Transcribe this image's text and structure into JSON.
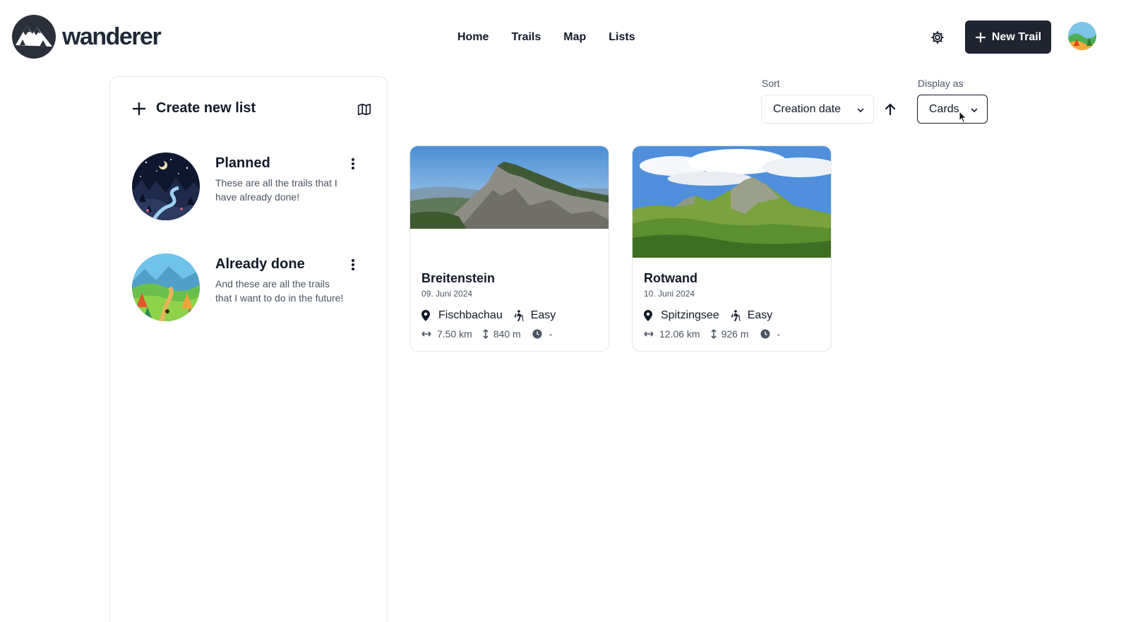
{
  "app": {
    "name": "wanderer"
  },
  "nav": {
    "items": [
      "Home",
      "Trails",
      "Map",
      "Lists"
    ]
  },
  "header": {
    "new_trail_label": "New Trail"
  },
  "sidebar": {
    "create_label": "Create new list",
    "lists": [
      {
        "title": "Planned",
        "description": "These are all the trails that I have already done!"
      },
      {
        "title": "Already done",
        "description": "And these are all the trails that I want to do in the future!"
      }
    ]
  },
  "controls": {
    "sort_label": "Sort",
    "sort_value": "Creation date",
    "display_label": "Display as",
    "display_value": "Cards"
  },
  "trails": [
    {
      "name": "Breitenstein",
      "date": "09. Juni 2024",
      "location": "Fischbachau",
      "difficulty": "Easy",
      "distance": "7.50 km",
      "elevation": "840 m",
      "duration": "-"
    },
    {
      "name": "Rotwand",
      "date": "10. Juni 2024",
      "location": "Spitzingsee",
      "difficulty": "Easy",
      "distance": "12.06 km",
      "elevation": "926 m",
      "duration": "-"
    }
  ],
  "colors": {
    "primary_dark": "#1f2430",
    "text_muted": "#4b5563",
    "border": "#e5e7eb"
  }
}
